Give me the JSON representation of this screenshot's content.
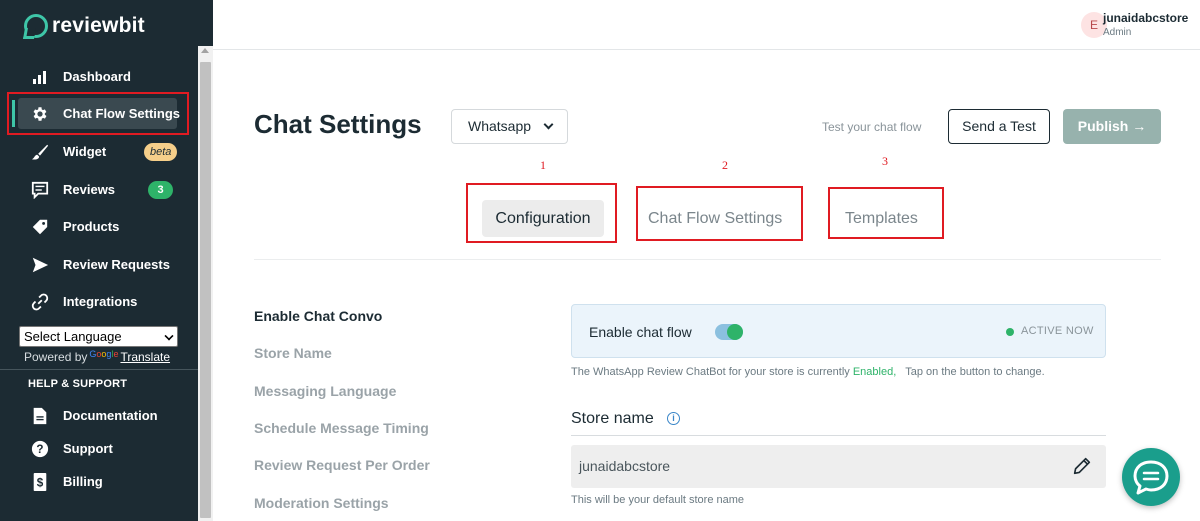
{
  "brand": {
    "name": "reviewbit",
    "accent": "#3ec6a8"
  },
  "sidebar": {
    "items": [
      {
        "label": "Dashboard",
        "icon": "bar-chart-icon"
      },
      {
        "label": "Chat Flow Settings",
        "icon": "gear-icon",
        "active": true
      },
      {
        "label": "Widget",
        "icon": "brush-icon",
        "badge": "beta"
      },
      {
        "label": "Reviews",
        "icon": "review-icon",
        "badge": "3"
      },
      {
        "label": "Products",
        "icon": "tag-icon"
      },
      {
        "label": "Review Requests",
        "icon": "send-icon"
      },
      {
        "label": "Integrations",
        "icon": "link-icon"
      }
    ],
    "language": {
      "selected": "Select Language",
      "powered_by": "Powered by",
      "google": "Google",
      "translate": "Translate"
    },
    "help_heading": "HELP & SUPPORT",
    "help_items": [
      {
        "label": "Documentation",
        "icon": "document-icon"
      },
      {
        "label": "Support",
        "icon": "question-icon"
      },
      {
        "label": "Billing",
        "icon": "dollar-icon"
      }
    ]
  },
  "topbar": {
    "avatar_letter": "E",
    "user_name": "junaidabcstore",
    "user_role": "Admin"
  },
  "main": {
    "title": "Chat Settings",
    "channel": "Whatsapp",
    "test_text": "Test your chat flow",
    "send_test": "Send a Test",
    "publish": "Publish →",
    "tabs": [
      {
        "num": "1",
        "label": "Configuration",
        "active": true
      },
      {
        "num": "2",
        "label": "Chat Flow Settings"
      },
      {
        "num": "3",
        "label": "Templates"
      }
    ],
    "settings_nav": [
      "Enable Chat Convo",
      "Store Name",
      "Messaging Language",
      "Schedule Message Timing",
      "Review Request Per Order",
      "Moderation Settings"
    ],
    "enable": {
      "label": "Enable chat flow",
      "status": "ACTIVE NOW",
      "note_prefix": "The WhatsApp Review ChatBot for your store is currently",
      "note_state": "Enabled,",
      "note_suffix": "Tap on the button to change."
    },
    "store": {
      "label": "Store name",
      "value": "junaidabcstore",
      "hint": "This will be your default store name"
    }
  },
  "colors": {
    "sidebar_bg": "#1c2b33",
    "highlight_red": "#e01b22",
    "success_green": "#2eb369",
    "publish_bg": "#97b2ad"
  }
}
